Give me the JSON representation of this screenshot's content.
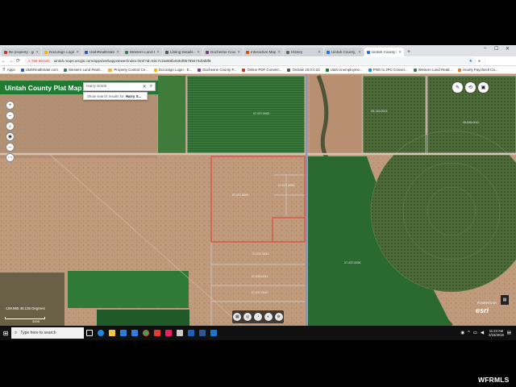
{
  "browser": {
    "tabs": [
      {
        "label": "Be property - ge...",
        "color": "#c0392b",
        "active": false
      },
      {
        "label": "DocuSign Login - ...",
        "color": "#f4b400",
        "active": false
      },
      {
        "label": "UtahRealEstate.com",
        "color": "#2a5db0",
        "active": false
      },
      {
        "label": "Western Land Realt...",
        "color": "#3b7a57",
        "active": false
      },
      {
        "label": "Listing Details - W...",
        "color": "#555555",
        "active": false
      },
      {
        "label": "Duchesne County ...",
        "color": "#7a3b7a",
        "active": false
      },
      {
        "label": "Interactive Map ...",
        "color": "#d35400",
        "active": false
      },
      {
        "label": "History",
        "color": "#666666",
        "active": false
      },
      {
        "label": "Uintah County, UT",
        "color": "#1a73e8",
        "active": false
      },
      {
        "label": "Uintah County Pla...",
        "color": "#1a73e8",
        "active": true
      }
    ],
    "new_tab": "+",
    "window_controls": {
      "min": "–",
      "max": "☐",
      "close": "✕"
    },
    "address": {
      "not_secure": "Not secure",
      "url": "uintah.maps.arcgis.com/apps/webappviewer/index.html?id=52c7c2a858b4494f85799474d0d8f6"
    },
    "bookmarks": [
      {
        "label": "Apps",
        "type": "apps"
      },
      {
        "label": "UtahRealEstate.com",
        "type": "site",
        "color": "#2a5db0"
      },
      {
        "label": "Western Land Realt...",
        "type": "site",
        "color": "#3b7a57"
      },
      {
        "label": "Property Control Ce...",
        "type": "folder"
      },
      {
        "label": "DocuSign Login - E...",
        "type": "site",
        "color": "#f4b400"
      },
      {
        "label": "Duchesne County P...",
        "type": "site",
        "color": "#7a3b7a"
      },
      {
        "label": "Online PDF Convert...",
        "type": "site",
        "color": "#c0392b"
      },
      {
        "label": "OnSale 10.0.0.23",
        "type": "site",
        "color": "#555555"
      },
      {
        "label": "Utah Unemployme...",
        "type": "site",
        "color": "#1f7a32"
      },
      {
        "label": "PNG to JPG Conver...",
        "type": "site",
        "color": "#2e86c1"
      },
      {
        "label": "Western Land Realt...",
        "type": "site",
        "color": "#3b7a57"
      },
      {
        "label": "Hourly Paycheck Ca...",
        "type": "site",
        "color": "#e67e22"
      }
    ]
  },
  "app": {
    "title": "Uintah County Plat Map",
    "subtitle": "Vernal, Utah",
    "search": {
      "value": "Harry Smith",
      "clear": "✕",
      "go_icon": "search-icon"
    },
    "suggestion": {
      "prefix": "Show search results for",
      "term": "Harry S..."
    },
    "zoom_tools": [
      "+",
      "–",
      "⌂",
      "◉",
      "⇔",
      "⋯"
    ],
    "right_tools": [
      "✎",
      "⟲",
      "▣"
    ],
    "coords": "-109.965 40.135 Degrees",
    "scale": "300ft",
    "bottom_tools": [
      "▦",
      "◎",
      "◔",
      "◐",
      "⊕"
    ],
    "powered_by": "POWERED BY",
    "esri": "esri",
    "side_toggle": "▤",
    "parcel_labels": [
      "07-037-0062",
      "05-126-0013",
      "07-037-0054",
      "07-037-0053",
      "07-037-0044",
      "07-035-0041",
      "07-037-0019",
      "05-026-0011",
      "07-037-0036"
    ]
  },
  "taskbar": {
    "start_icon": "windows-icon",
    "search_placeholder": "Type here to search",
    "apps": [
      {
        "name": "task-view",
        "color": "#ffffff"
      },
      {
        "name": "edge",
        "color": "#1e88e5"
      },
      {
        "name": "explorer",
        "color": "#f4c542"
      },
      {
        "name": "store",
        "color": "#2a7de1"
      },
      {
        "name": "mail",
        "color": "#2f7de1"
      },
      {
        "name": "chrome",
        "color": "#34a853"
      },
      {
        "name": "app-red",
        "color": "#e53935"
      },
      {
        "name": "app-pink",
        "color": "#e91e63"
      },
      {
        "name": "calculator",
        "color": "#cccccc"
      },
      {
        "name": "app-blue",
        "color": "#1565c0"
      },
      {
        "name": "word",
        "color": "#2b5797"
      },
      {
        "name": "outlook",
        "color": "#1976d2"
      }
    ],
    "time": "11:24 AM",
    "date": "2/15/2019"
  },
  "watermark": "WFRMLS"
}
